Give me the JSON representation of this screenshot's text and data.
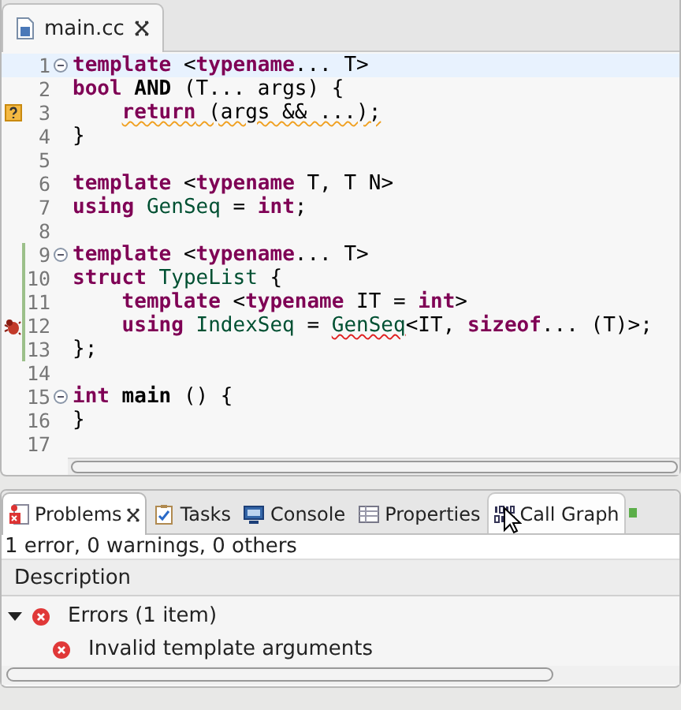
{
  "editor_tabs": [
    {
      "label": "main.cc",
      "selected": true,
      "closable": true
    }
  ],
  "code_lines": [
    {
      "number": "1",
      "fold": true,
      "current": true,
      "changed": false,
      "indented": false,
      "has_warning": false,
      "has_error": false,
      "tokens": [
        {
          "kind": "keyword",
          "text": "template"
        },
        {
          "kind": "text",
          "text": " <"
        },
        {
          "kind": "keyword",
          "text": "typename"
        },
        {
          "kind": "text",
          "text": "... T>"
        }
      ]
    },
    {
      "number": "2",
      "fold": false,
      "current": false,
      "changed": false,
      "indented": false,
      "has_warning": false,
      "has_error": false,
      "tokens": [
        {
          "kind": "keyword",
          "text": "bool"
        },
        {
          "kind": "bold",
          "text": " AND"
        },
        {
          "kind": "text",
          "text": " (T... args) {"
        }
      ]
    },
    {
      "number": "3",
      "fold": false,
      "current": false,
      "changed": false,
      "indented": true,
      "has_warning": true,
      "has_error": false,
      "tokens": [
        {
          "kind": "keyword",
          "text": "return",
          "warning_underline": true
        },
        {
          "kind": "text",
          "text": " (args && ...);",
          "warning_underline": true
        }
      ]
    },
    {
      "number": "4",
      "fold": false,
      "current": false,
      "changed": false,
      "indented": false,
      "has_warning": false,
      "has_error": false,
      "tokens": [
        {
          "kind": "text",
          "text": "}"
        }
      ]
    },
    {
      "number": "5",
      "fold": false,
      "current": false,
      "changed": false,
      "has_warning": false,
      "has_error": false
    },
    {
      "number": "6",
      "fold": false,
      "current": false,
      "changed": false,
      "indented": false,
      "has_warning": false,
      "has_error": false,
      "tokens": [
        {
          "kind": "keyword",
          "text": "template"
        },
        {
          "kind": "text",
          "text": " <"
        },
        {
          "kind": "keyword",
          "text": "typename"
        },
        {
          "kind": "text",
          "text": " T, T N>"
        }
      ]
    },
    {
      "number": "7",
      "fold": false,
      "current": false,
      "changed": false,
      "indented": false,
      "has_warning": false,
      "has_error": false,
      "tokens": [
        {
          "kind": "keyword",
          "text": "using"
        },
        {
          "kind": "name",
          "text": " GenSeq"
        },
        {
          "kind": "text",
          "text": " = "
        },
        {
          "kind": "keyword",
          "text": "int"
        },
        {
          "kind": "text",
          "text": ";"
        }
      ]
    },
    {
      "number": "8",
      "fold": false,
      "current": false,
      "changed": false,
      "has_warning": false,
      "has_error": false
    },
    {
      "number": "9",
      "fold": true,
      "current": false,
      "changed": true,
      "indented": false,
      "has_warning": false,
      "has_error": false,
      "tokens": [
        {
          "kind": "keyword",
          "text": "template"
        },
        {
          "kind": "text",
          "text": " <"
        },
        {
          "kind": "keyword",
          "text": "typename"
        },
        {
          "kind": "text",
          "text": "... T>"
        }
      ]
    },
    {
      "number": "10",
      "fold": false,
      "current": false,
      "changed": true,
      "indented": false,
      "has_warning": false,
      "has_error": false,
      "tokens": [
        {
          "kind": "keyword",
          "text": "struct"
        },
        {
          "kind": "name",
          "text": " TypeList"
        },
        {
          "kind": "text",
          "text": " {"
        }
      ]
    },
    {
      "number": "11",
      "fold": false,
      "current": false,
      "changed": true,
      "indented": true,
      "has_warning": false,
      "has_error": false,
      "tokens": [
        {
          "kind": "keyword",
          "text": "template"
        },
        {
          "kind": "text",
          "text": " <"
        },
        {
          "kind": "keyword",
          "text": "typename"
        },
        {
          "kind": "text",
          "text": " IT = "
        },
        {
          "kind": "keyword",
          "text": "int"
        },
        {
          "kind": "text",
          "text": ">"
        }
      ]
    },
    {
      "number": "12",
      "fold": false,
      "current": false,
      "changed": true,
      "indented": true,
      "has_warning": false,
      "has_error": true,
      "tokens": [
        {
          "kind": "keyword",
          "text": "using"
        },
        {
          "kind": "name",
          "text": " IndexSeq"
        },
        {
          "kind": "text",
          "text": " = "
        },
        {
          "kind": "name",
          "text": "GenSeq",
          "error_underline": true
        },
        {
          "kind": "text",
          "text": "<IT, "
        },
        {
          "kind": "keyword",
          "text": "sizeof"
        },
        {
          "kind": "text",
          "text": "... (T)>;"
        }
      ]
    },
    {
      "number": "13",
      "fold": false,
      "current": false,
      "changed": true,
      "indented": false,
      "has_warning": false,
      "has_error": false,
      "tokens": [
        {
          "kind": "text",
          "text": "};"
        }
      ]
    },
    {
      "number": "14",
      "fold": false,
      "current": false,
      "changed": false,
      "has_warning": false,
      "has_error": false
    },
    {
      "number": "15",
      "fold": true,
      "current": false,
      "changed": false,
      "indented": false,
      "has_warning": false,
      "has_error": false,
      "tokens": [
        {
          "kind": "keyword",
          "text": "int"
        },
        {
          "kind": "bold",
          "text": " main"
        },
        {
          "kind": "text",
          "text": " () {"
        }
      ]
    },
    {
      "number": "16",
      "fold": false,
      "current": false,
      "changed": false,
      "indented": false,
      "has_warning": false,
      "has_error": false,
      "tokens": [
        {
          "kind": "text",
          "text": "}"
        }
      ]
    },
    {
      "number": "17",
      "fold": false,
      "current": false,
      "changed": false,
      "has_warning": false,
      "has_error": false
    }
  ],
  "view_tabs": [
    {
      "label": "Problems",
      "selected": true,
      "closable": true,
      "hovered": false
    },
    {
      "label": "Tasks",
      "selected": false,
      "closable": false,
      "hovered": false
    },
    {
      "label": "Console",
      "selected": false,
      "closable": false,
      "hovered": false
    },
    {
      "label": "Properties",
      "selected": false,
      "closable": false,
      "hovered": false
    },
    {
      "label": "Call Graph",
      "selected": false,
      "closable": false,
      "hovered": true
    }
  ],
  "problems": {
    "summary": "1 error, 0 warnings, 0 others",
    "columns": [
      "Description"
    ],
    "tree": [
      {
        "label": "Errors (1 item)",
        "kind": "error",
        "expanded": true,
        "children": [
          {
            "label": "Invalid template arguments",
            "kind": "error"
          }
        ]
      }
    ]
  }
}
